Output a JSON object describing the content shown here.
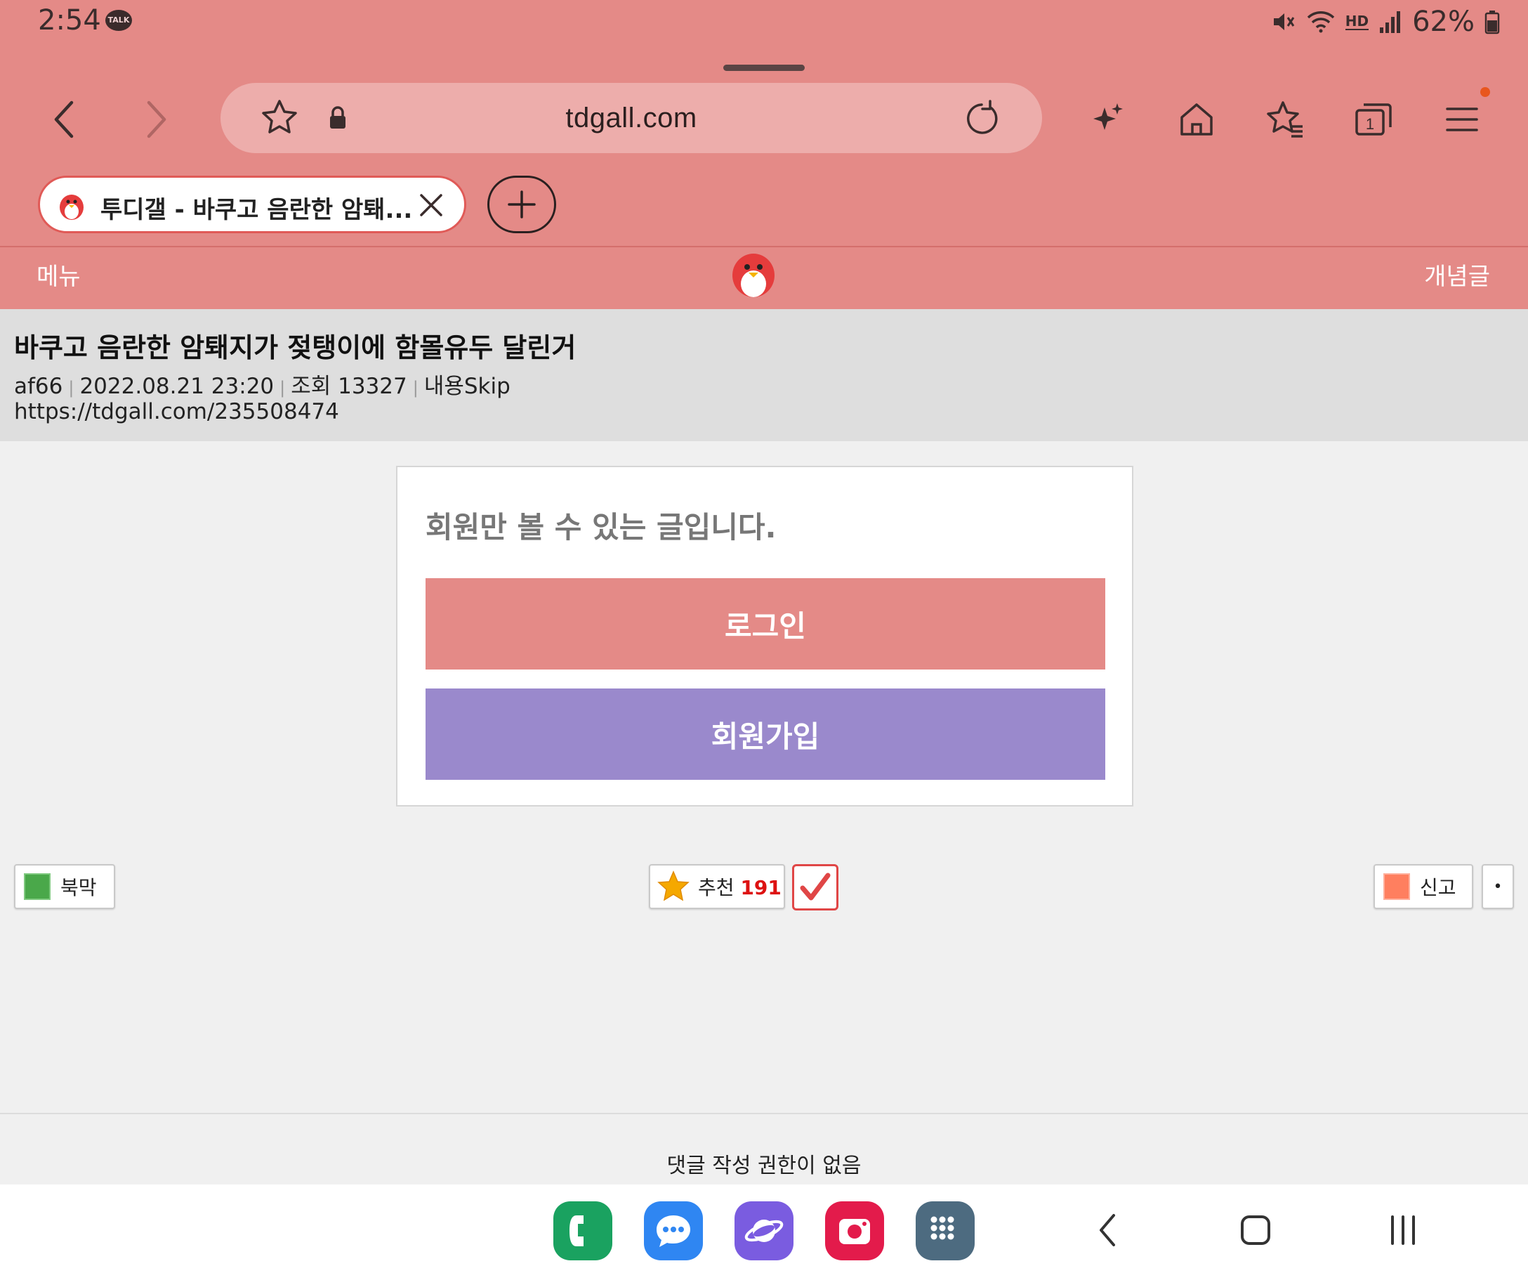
{
  "status_bar": {
    "time": "2:54",
    "talk_badge": "TALK",
    "hd_label": "HD",
    "battery": "62%"
  },
  "browser": {
    "url": "tdgall.com",
    "tab_title": "투디갤 - 바쿠고 음란한 암퇘...",
    "icons": [
      "back-arrow",
      "forward-arrow",
      "bookmark-star",
      "lock",
      "reload",
      "ai-sparkle",
      "home",
      "bookmarks",
      "tabs",
      "menu"
    ],
    "tab_count": "1",
    "accent": "#e48a87",
    "notification_dot": "#e8561e"
  },
  "site_header": {
    "menu": "메뉴",
    "right_link": "개념글"
  },
  "article": {
    "title": "바쿠고 음란한 암퇘지가 젖탱이에 함몰유두 달린거",
    "author": "af66",
    "datetime": "2022.08.21 23:20",
    "views": "조회 13327",
    "skip": "내용Skip",
    "url": "https://tdgall.com/235508474"
  },
  "members_only": {
    "message": "회원만 볼 수 있는 글입니다.",
    "login": "로그인",
    "signup": "회원가입",
    "login_color": "#e48a87",
    "signup_color": "#9a89cc"
  },
  "actions": {
    "block": "북막",
    "recommend_label": "추천",
    "recommend_count": "191",
    "report": "신고",
    "more": "•"
  },
  "comments": {
    "note": "댓글 작성 권한이 없음"
  },
  "dock": {
    "apps": [
      "phone-icon",
      "messages-icon",
      "internet-icon",
      "camera-icon",
      "apps-grid-icon"
    ]
  }
}
